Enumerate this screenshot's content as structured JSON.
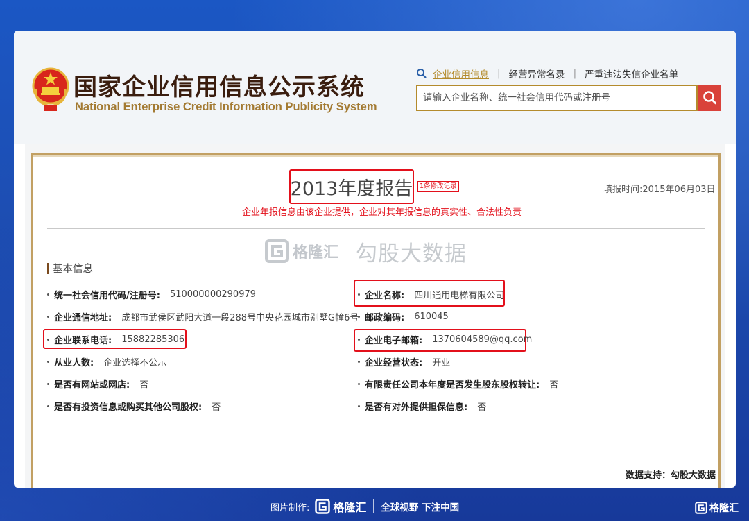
{
  "site": {
    "title_cn": "国家企业信用信息公示系统",
    "title_en": "National Enterprise Credit Information Publicity System"
  },
  "nav": {
    "items": [
      "企业信用信息",
      "经营异常名录",
      "严重违法失信企业名单"
    ]
  },
  "search": {
    "placeholder": "请输入企业名称、统一社会信用代码或注册号"
  },
  "report": {
    "title": "2013年度报告",
    "revise_badge": "1条修改记录",
    "fill_time": "填报时间:2015年06月03日",
    "notice": "企业年报信息由该企业提供，企业对其年报信息的真实性、合法性负责"
  },
  "watermark": {
    "brand": "格隆汇",
    "text": "勾股大数据"
  },
  "basic_info": {
    "section_title": "基本信息",
    "fields": [
      {
        "label": "统一社会信用代码/注册号:",
        "value": "510000000290979"
      },
      {
        "label": "企业名称:",
        "value": "四川通用电梯有限公司"
      },
      {
        "label": "企业通信地址:",
        "value": "成都市武侯区武阳大道一段288号中央花园城市别墅G幢6号"
      },
      {
        "label": "邮政编码:",
        "value": "610045"
      },
      {
        "label": "企业联系电话:",
        "value": "15882285306"
      },
      {
        "label": "企业电子邮箱:",
        "value": "1370604589@qq.com"
      },
      {
        "label": "从业人数:",
        "value": "企业选择不公示"
      },
      {
        "label": "企业经营状态:",
        "value": "开业"
      },
      {
        "label": "是否有网站或网店:",
        "value": "否"
      },
      {
        "label": "有限责任公司本年度是否发生股东股权转让:",
        "value": "否"
      },
      {
        "label": "是否有投资信息或购买其他公司股权:",
        "value": "否"
      },
      {
        "label": "是否有对外提供担保信息:",
        "value": "否"
      }
    ]
  },
  "footer": {
    "source": "数据支持：勾股大数据",
    "made_by_label": "图片制作:",
    "brand": "格隆汇",
    "slogan": "全球视野 下注中国",
    "corner_brand": "格隆汇"
  },
  "colors": {
    "highlight": "#e3101b",
    "frame_gold": "#c2a063",
    "search_button": "#d9423a",
    "page_background": "#1b57c4"
  }
}
